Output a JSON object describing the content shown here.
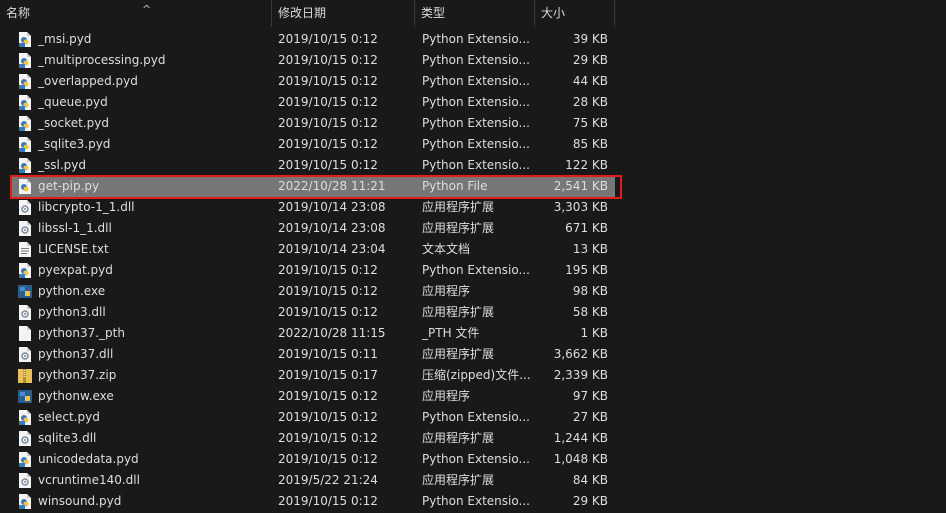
{
  "columns": {
    "name": "名称",
    "date": "修改日期",
    "type": "类型",
    "size": "大小"
  },
  "files": [
    {
      "name": "_msi.pyd",
      "date": "2019/10/15 0:12",
      "type": "Python Extensio...",
      "size": "39 KB",
      "icon": "pyd-file-icon"
    },
    {
      "name": "_multiprocessing.pyd",
      "date": "2019/10/15 0:12",
      "type": "Python Extensio...",
      "size": "29 KB",
      "icon": "pyd-file-icon"
    },
    {
      "name": "_overlapped.pyd",
      "date": "2019/10/15 0:12",
      "type": "Python Extensio...",
      "size": "44 KB",
      "icon": "pyd-file-icon"
    },
    {
      "name": "_queue.pyd",
      "date": "2019/10/15 0:12",
      "type": "Python Extensio...",
      "size": "28 KB",
      "icon": "pyd-file-icon"
    },
    {
      "name": "_socket.pyd",
      "date": "2019/10/15 0:12",
      "type": "Python Extensio...",
      "size": "75 KB",
      "icon": "pyd-file-icon"
    },
    {
      "name": "_sqlite3.pyd",
      "date": "2019/10/15 0:12",
      "type": "Python Extensio...",
      "size": "85 KB",
      "icon": "pyd-file-icon"
    },
    {
      "name": "_ssl.pyd",
      "date": "2019/10/15 0:12",
      "type": "Python Extensio...",
      "size": "122 KB",
      "icon": "pyd-file-icon"
    },
    {
      "name": "get-pip.py",
      "date": "2022/10/28 11:21",
      "type": "Python File",
      "size": "2,541 KB",
      "icon": "python-file-icon",
      "selected": true
    },
    {
      "name": "libcrypto-1_1.dll",
      "date": "2019/10/14 23:08",
      "type": "应用程序扩展",
      "size": "3,303 KB",
      "icon": "dll-file-icon"
    },
    {
      "name": "libssl-1_1.dll",
      "date": "2019/10/14 23:08",
      "type": "应用程序扩展",
      "size": "671 KB",
      "icon": "dll-file-icon"
    },
    {
      "name": "LICENSE.txt",
      "date": "2019/10/14 23:04",
      "type": "文本文档",
      "size": "13 KB",
      "icon": "text-file-icon"
    },
    {
      "name": "pyexpat.pyd",
      "date": "2019/10/15 0:12",
      "type": "Python Extensio...",
      "size": "195 KB",
      "icon": "pyd-file-icon"
    },
    {
      "name": "python.exe",
      "date": "2019/10/15 0:12",
      "type": "应用程序",
      "size": "98 KB",
      "icon": "python-exe-icon"
    },
    {
      "name": "python3.dll",
      "date": "2019/10/15 0:12",
      "type": "应用程序扩展",
      "size": "58 KB",
      "icon": "dll-file-icon"
    },
    {
      "name": "python37._pth",
      "date": "2022/10/28 11:15",
      "type": "_PTH 文件",
      "size": "1 KB",
      "icon": "blank-file-icon"
    },
    {
      "name": "python37.dll",
      "date": "2019/10/15 0:11",
      "type": "应用程序扩展",
      "size": "3,662 KB",
      "icon": "dll-file-icon"
    },
    {
      "name": "python37.zip",
      "date": "2019/10/15 0:17",
      "type": "压缩(zipped)文件...",
      "size": "2,339 KB",
      "icon": "zip-file-icon"
    },
    {
      "name": "pythonw.exe",
      "date": "2019/10/15 0:12",
      "type": "应用程序",
      "size": "97 KB",
      "icon": "python-exe-icon"
    },
    {
      "name": "select.pyd",
      "date": "2019/10/15 0:12",
      "type": "Python Extensio...",
      "size": "27 KB",
      "icon": "pyd-file-icon"
    },
    {
      "name": "sqlite3.dll",
      "date": "2019/10/15 0:12",
      "type": "应用程序扩展",
      "size": "1,244 KB",
      "icon": "dll-file-icon"
    },
    {
      "name": "unicodedata.pyd",
      "date": "2019/10/15 0:12",
      "type": "Python Extensio...",
      "size": "1,048 KB",
      "icon": "pyd-file-icon"
    },
    {
      "name": "vcruntime140.dll",
      "date": "2019/5/22 21:24",
      "type": "应用程序扩展",
      "size": "84 KB",
      "icon": "dll-file-icon"
    },
    {
      "name": "winsound.pyd",
      "date": "2019/10/15 0:12",
      "type": "Python Extensio...",
      "size": "29 KB",
      "icon": "pyd-file-icon"
    }
  ],
  "colors": {
    "background": "#191919",
    "text": "#dedede",
    "selection": "#777777",
    "highlight_box": "#e21b1b"
  }
}
